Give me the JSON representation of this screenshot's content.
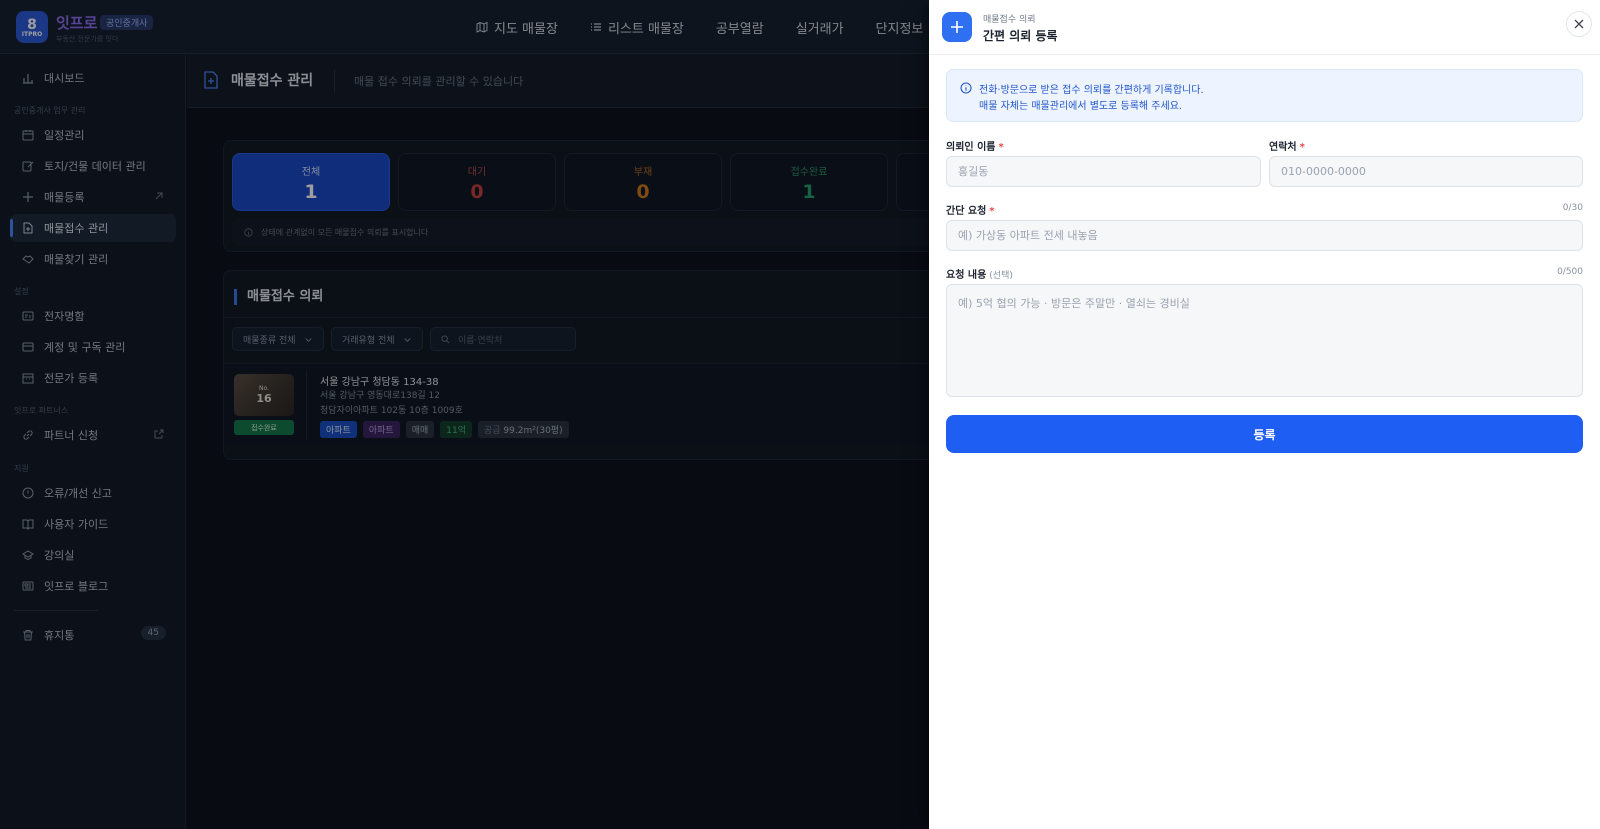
{
  "brand": {
    "logo_mark": "8",
    "logo_sub": "ITPRO",
    "name": "잇프로",
    "badge": "공인중개사",
    "tagline": "부동산 전문가를 잇다"
  },
  "top_nav": [
    {
      "label": "지도 매물장",
      "icon": "map-icon"
    },
    {
      "label": "리스트 매물장",
      "icon": "list-icon"
    },
    {
      "label": "공부열람"
    },
    {
      "label": "실거래가"
    },
    {
      "label": "단지정보"
    }
  ],
  "sidebar": {
    "dashboard": "대시보드",
    "section_work": "공인중개사 업무 관리",
    "schedule": "일정관리",
    "land_data": "토지/건물 데이터 관리",
    "listing_register": "매물등록",
    "listing_intake": "매물접수 관리",
    "listing_search": "매물찾기 관리",
    "section_settings": "설정",
    "business_card": "전자명함",
    "account": "계정 및 구독 관리",
    "expert": "전문가 등록",
    "section_partners": "잇프로 파트너스",
    "partner": "파트너 신청",
    "section_support": "지원",
    "report": "오류/개선 신고",
    "guide": "사용자 가이드",
    "lecture": "강의실",
    "blog": "잇프로 블로그",
    "trash": "휴지통",
    "trash_count": "45"
  },
  "page": {
    "title": "매물접수 관리",
    "description": "매물 접수 의뢰를 관리할 수 있습니다"
  },
  "stats": [
    {
      "label": "전체",
      "value": "1"
    },
    {
      "label": "대기",
      "value": "0"
    },
    {
      "label": "부재",
      "value": "0"
    },
    {
      "label": "접수완료",
      "value": "1"
    }
  ],
  "stat_note": "상태에 관계없이 모든 매물접수 의뢰를 표시합니다",
  "list": {
    "title": "매물접수 의뢰",
    "filter_type": "매물종류 전체",
    "filter_deal": "거래유형 전체",
    "search_placeholder": "이름·연락처",
    "row": {
      "thumb_no": "No.",
      "thumb_num": "16",
      "status": "접수완료",
      "address1": "서울 강남구 청담동 134-38",
      "address2": "서울 강남구 영동대로138길 12",
      "address3": "청담자이아파트 102동 10층 1009호",
      "tag_type": "아파트",
      "tag_type2": "아파트",
      "tag_deal": "매매",
      "tag_price": "11억",
      "tag_area_label": "공급",
      "tag_area": "99.2m²(30평)"
    }
  },
  "drawer": {
    "subtitle": "매물접수 의뢰",
    "title": "간편 의뢰 등록",
    "info_line1": "전화·방문으로 받은 접수 의뢰를 간편하게 기록합니다.",
    "info_line2": "매물 자체는 매물관리에서 별도로 등록해 주세요.",
    "name_label": "의뢰인 이름",
    "name_placeholder": "홍길동",
    "phone_label": "연락처",
    "phone_placeholder": "010-0000-0000",
    "brief_label": "간단 요청",
    "brief_count": "0/30",
    "brief_placeholder": "예) 가상동 아파트 전세 내놓음",
    "detail_label": "요청 내용",
    "detail_optional": "(선택)",
    "detail_count": "0/500",
    "detail_placeholder": "예) 5억 협의 가능 · 방문은 주말만 · 열쇠는 경비실",
    "required_mark": "*",
    "submit_label": "등록"
  },
  "colors": {
    "accent": "#1f5ef3",
    "required": "#e5484d",
    "status_done": "#16794b"
  }
}
